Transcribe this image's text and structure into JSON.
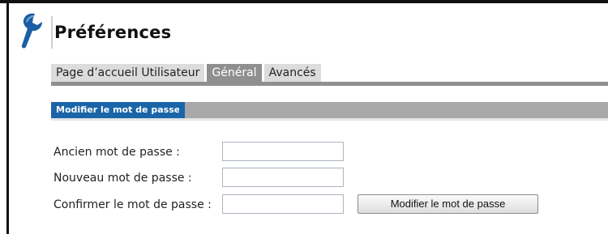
{
  "header": {
    "title": "Préférences",
    "logo_icon": "wrench-icon"
  },
  "tabs": [
    {
      "label": "Page d’accueil Utilisateur",
      "active": false
    },
    {
      "label": "Général",
      "active": true
    },
    {
      "label": "Avancés",
      "active": false
    }
  ],
  "section": {
    "title": "Modifier le mot de passe"
  },
  "form": {
    "old_password_label": "Ancien mot de passe :",
    "old_password_value": "",
    "new_password_label": "Nouveau mot de passe :",
    "new_password_value": "",
    "confirm_password_label": "Confirmer le mot de passe :",
    "confirm_password_value": "",
    "submit_label": "Modifier le mot de passe"
  },
  "colors": {
    "accent": "#1a65a8",
    "tab_active": "#8f8f8f",
    "tab_inactive": "#dcdcdc",
    "section_bar": "#a8a8a8"
  }
}
